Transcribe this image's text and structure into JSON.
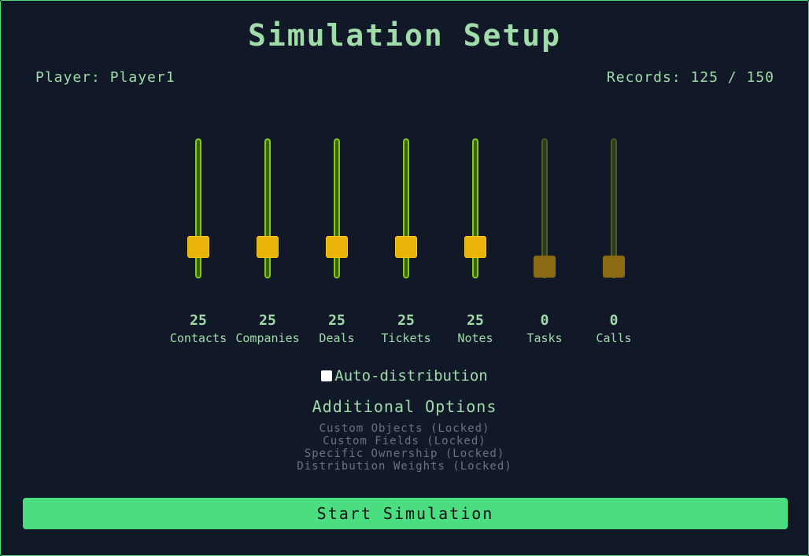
{
  "header": {
    "title": "Simulation Setup",
    "player_label": "Player: Player1",
    "records_label": "Records: 125 / 150"
  },
  "sliders": [
    {
      "label": "Contacts",
      "value": "25",
      "enabled": true
    },
    {
      "label": "Companies",
      "value": "25",
      "enabled": true
    },
    {
      "label": "Deals",
      "value": "25",
      "enabled": true
    },
    {
      "label": "Tickets",
      "value": "25",
      "enabled": true
    },
    {
      "label": "Notes",
      "value": "25",
      "enabled": true
    },
    {
      "label": "Tasks",
      "value": "0",
      "enabled": false
    },
    {
      "label": "Calls",
      "value": "0",
      "enabled": false
    }
  ],
  "auto_distribution": {
    "label": "Auto-distribution",
    "checked": false
  },
  "additional_options": {
    "title": "Additional Options",
    "items": [
      "Custom Objects (Locked)",
      "Custom Fields (Locked)",
      "Specific Ownership (Locked)",
      "Distribution Weights (Locked)"
    ]
  },
  "start_button": {
    "label": "Start Simulation"
  },
  "colors": {
    "accent": "#4ade80",
    "thumb": "#eab308",
    "track": "#84cc16",
    "background": "#111827"
  }
}
